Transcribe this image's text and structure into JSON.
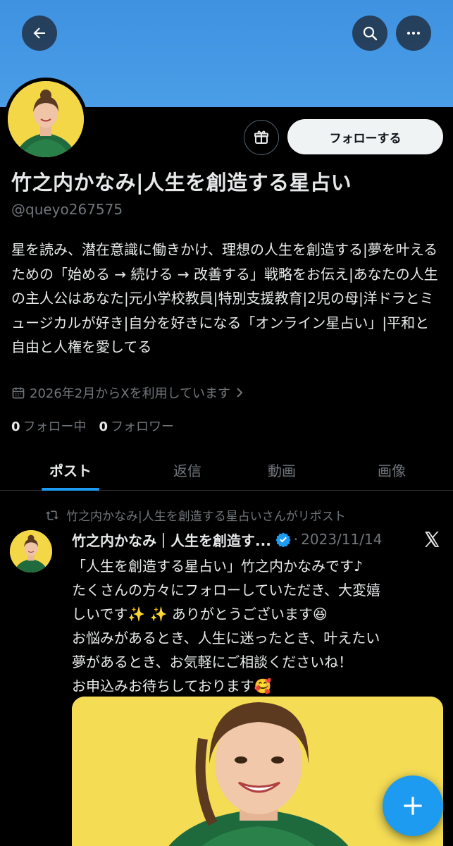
{
  "header": {
    "back_icon": "arrow-left-icon",
    "search_icon": "search-icon",
    "more_icon": "more-horizontal-icon"
  },
  "profile": {
    "display_name": "竹之内かなみ|人生を創造する星占い",
    "handle": "@queyo267575",
    "follow_label": "フォローする",
    "gift_icon": "gift-icon",
    "bio": "星を読み、潜在意識に働きかけ、理想の人生を創造する|夢を叶えるための「始める → 続ける → 改善する」戦略をお伝え|あなたの人生の主人公はあなた|元小学校教員|特別支援教育|2児の母|洋ドラとミュージカルが好き|自分を好きになる「オンライン星占い」|平和と自由と人権を愛してる",
    "joined": "2026年2月からXを利用しています",
    "following_count": "0",
    "following_label": "フォロー中",
    "followers_count": "0",
    "followers_label": "フォロワー"
  },
  "tabs": [
    {
      "label": "ポスト",
      "active": true
    },
    {
      "label": "返信",
      "active": false
    },
    {
      "label": "動画",
      "active": false
    },
    {
      "label": "画像",
      "active": false
    }
  ],
  "post": {
    "repost_text": "竹之内かなみ|人生を創造する星占いさんがリポスト",
    "author": "竹之内かなみ｜人生を創造す...",
    "dot": "·",
    "date": "2023/11/14",
    "lines": [
      "「人生を創造する星占い」竹之内かなみです♪",
      "たくさんの方々にフォローしていただき、大変嬉",
      "しいです✨ ✨ ありがとうございます😆",
      "お悩みがあるとき、人生に迷ったとき、叶えたい",
      "夢があるとき、お気軽にご相談くださいね！",
      "お申込みお待ちしております🥰"
    ]
  },
  "fab": {
    "icon": "plus-icon"
  },
  "colors": {
    "banner": "#4a9de6",
    "accent": "#1d9bf0",
    "muted": "#71767b",
    "text": "#e7e9ea",
    "background": "#000000"
  }
}
